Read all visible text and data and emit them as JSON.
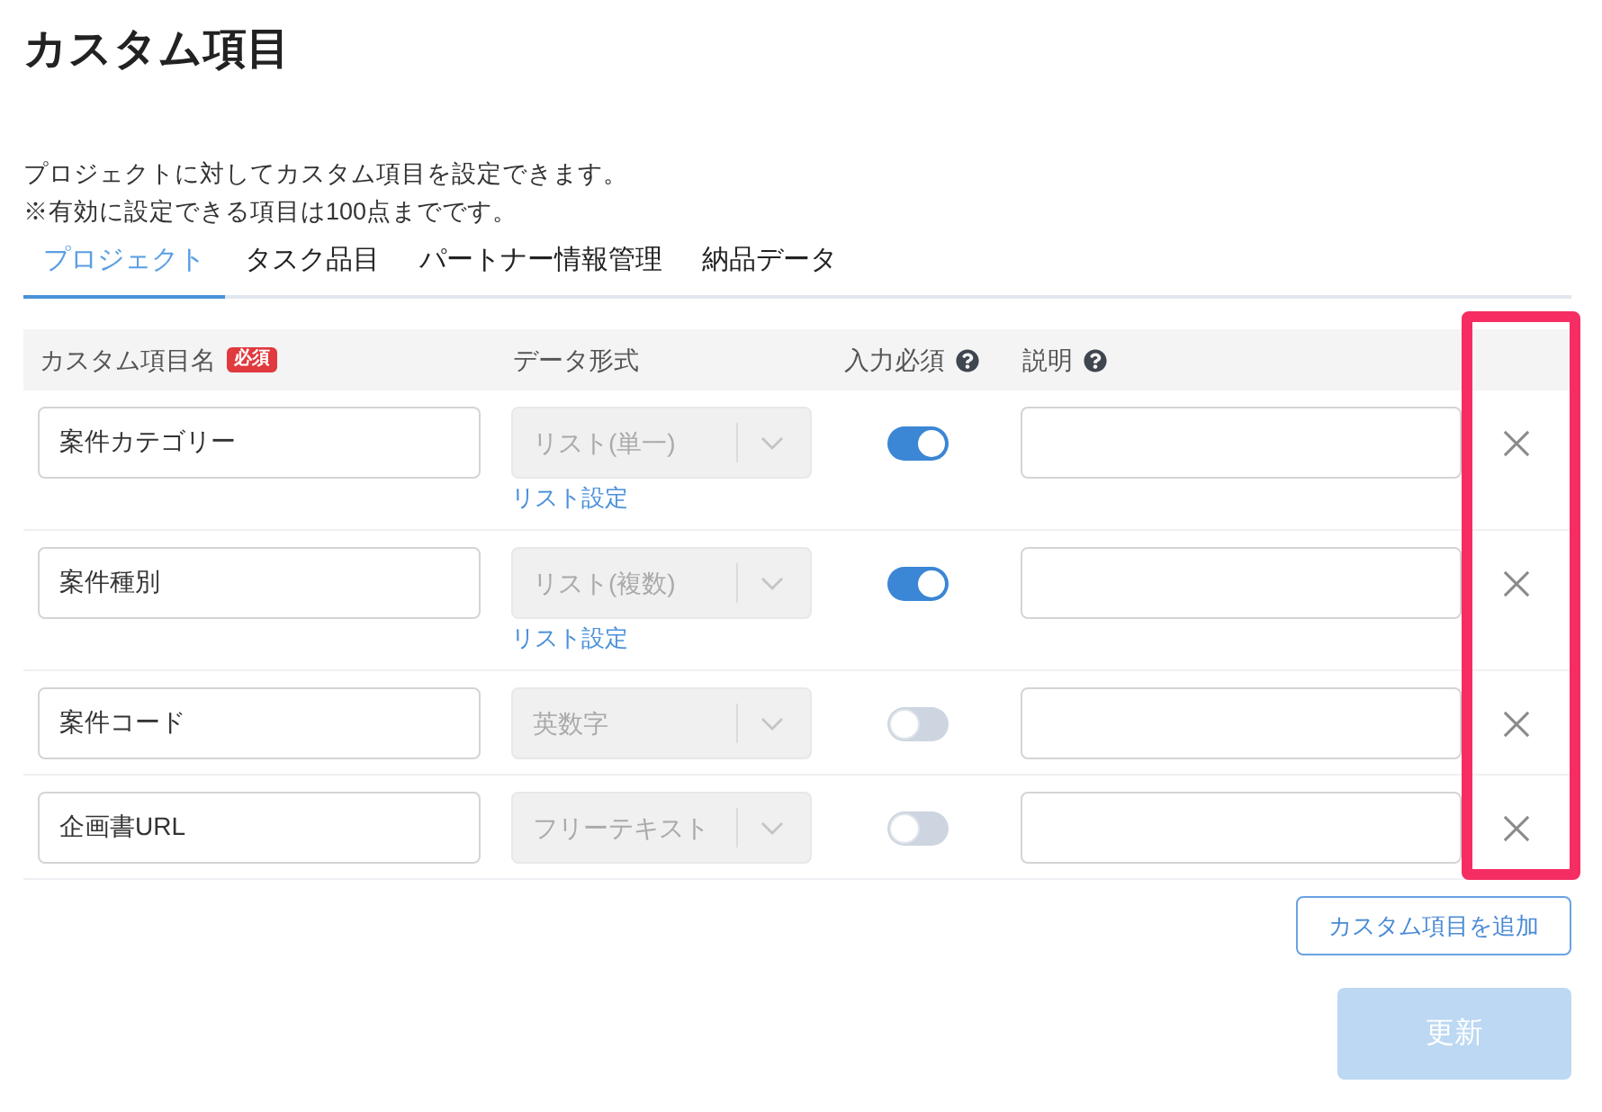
{
  "page": {
    "title": "カスタム項目",
    "description": [
      "プロジェクトに対してカスタム項目を設定できます。",
      "※有効に設定できる項目は100点までです。"
    ]
  },
  "tabs": [
    {
      "label": "プロジェクト",
      "selected": true
    },
    {
      "label": "タスク品目",
      "selected": false
    },
    {
      "label": "パートナー情報管理",
      "selected": false
    },
    {
      "label": "納品データ",
      "selected": false
    }
  ],
  "table": {
    "highlight_delete_column": true,
    "columns": [
      {
        "label": "カスタム項目名",
        "badge": "必須"
      },
      {
        "label": "データ形式"
      },
      {
        "label": "入力必須",
        "help": true
      },
      {
        "label": "説明",
        "help": true
      }
    ],
    "rows": [
      {
        "name": "案件カテゴリー",
        "data_type": {
          "value": "リスト(単一)",
          "disabled": true
        },
        "list_link": "リスト設定",
        "required": true
      },
      {
        "name": "案件種別",
        "data_type": {
          "value": "リスト(複数)",
          "disabled": true
        },
        "list_link": "リスト設定",
        "required": true
      },
      {
        "name": "案件コード",
        "data_type": {
          "value": "英数字",
          "disabled": true
        },
        "required": false
      },
      {
        "name": "企画書URL",
        "data_type": {
          "value": "フリーテキスト",
          "disabled": true
        },
        "required": false
      }
    ]
  },
  "add_button": {
    "label": "カスタム項目を追加"
  },
  "update_button": {
    "label": "更新",
    "disabled": true
  }
}
